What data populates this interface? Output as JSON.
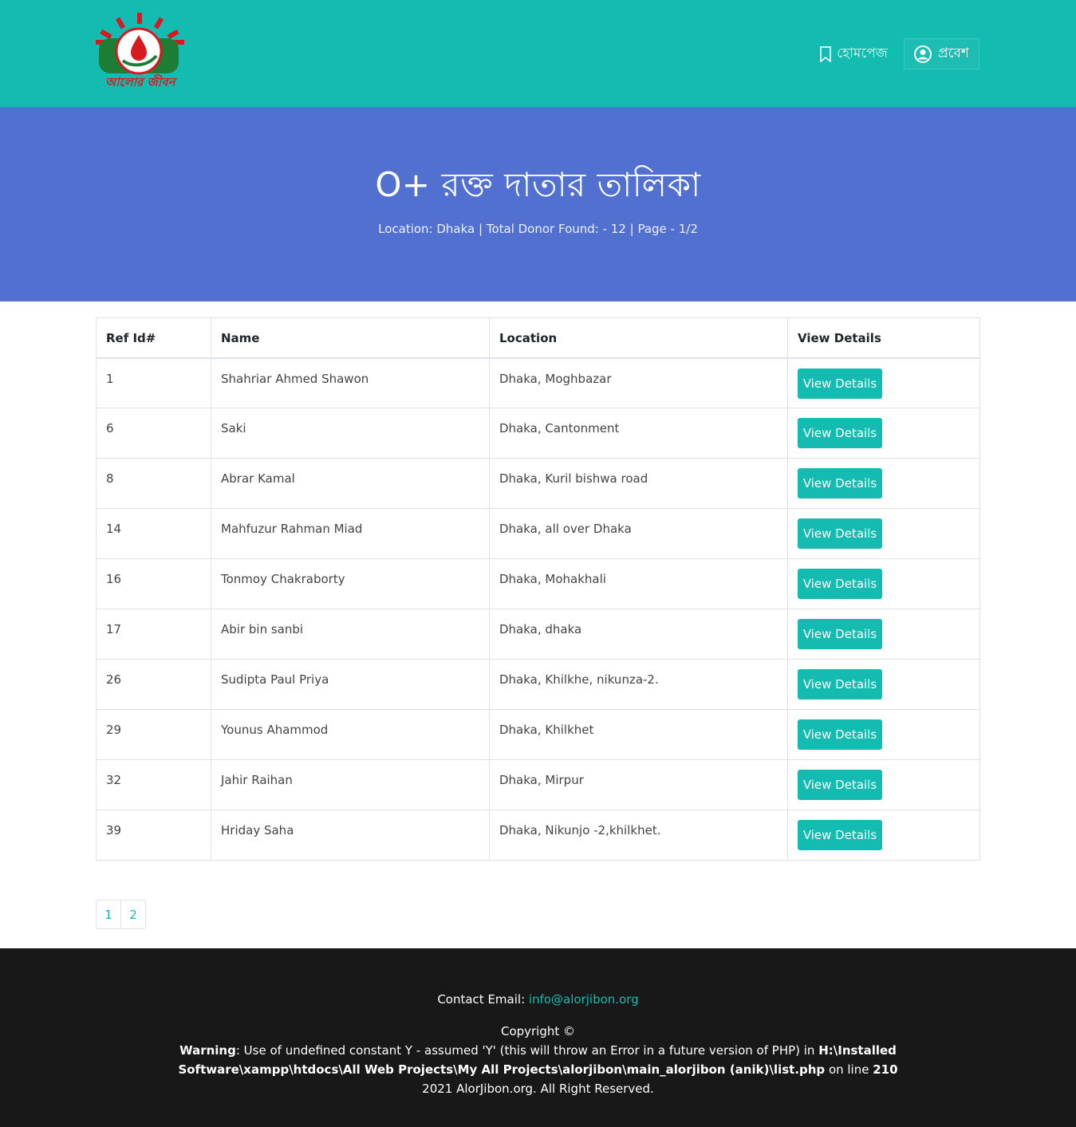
{
  "brand": {
    "logo_text": "আলোর জীবন"
  },
  "nav": {
    "home_label": "হোমপেজ",
    "login_label": "প্রবেশ"
  },
  "hero": {
    "title": "O+ রক্ত দাতার তালিকা",
    "subtitle": "Location: Dhaka | Total Donor Found: - 12 | Page - 1/2"
  },
  "table": {
    "headers": [
      "Ref Id#",
      "Name",
      "Location",
      "View Details"
    ],
    "button_label": "View Details",
    "rows": [
      {
        "id": "1",
        "name": "Shahriar Ahmed Shawon",
        "location": "Dhaka, Moghbazar"
      },
      {
        "id": "6",
        "name": "Saki",
        "location": "Dhaka, Cantonment"
      },
      {
        "id": "8",
        "name": "Abrar Kamal",
        "location": "Dhaka, Kuril bishwa road"
      },
      {
        "id": "14",
        "name": "Mahfuzur Rahman Miad",
        "location": "Dhaka, all over Dhaka"
      },
      {
        "id": "16",
        "name": "Tonmoy Chakraborty",
        "location": "Dhaka, Mohakhali"
      },
      {
        "id": "17",
        "name": "Abir bin sanbi",
        "location": "Dhaka, dhaka"
      },
      {
        "id": "26",
        "name": "Sudipta Paul Priya",
        "location": "Dhaka, Khilkhe, nikunza-2."
      },
      {
        "id": "29",
        "name": "Younus Ahammod",
        "location": "Dhaka, Khilkhet"
      },
      {
        "id": "32",
        "name": "Jahir Raihan",
        "location": "Dhaka, Mirpur"
      },
      {
        "id": "39",
        "name": "Hriday Saha",
        "location": "Dhaka, Nikunjo -2,khilkhet."
      }
    ]
  },
  "pagination": {
    "pages": [
      "1",
      "2"
    ]
  },
  "footer": {
    "contact_label": "Contact Email:",
    "email": "info@alorjibon.org",
    "copyright": "Copyright ©",
    "warning_label": "Warning",
    "warning_text": ": Use of undefined constant Y - assumed 'Y' (this will throw an Error in a future version of PHP) in ",
    "warning_path": "H:\\Installed Software\\xampp\\htdocs\\All Web Projects\\My All Projects\\alorjibon\\main_alorjibon (anik)\\list.php",
    "warning_on_line": " on line ",
    "warning_line": "210",
    "rights": "2021 AlorJibon.org. All Right Reserved."
  },
  "colors": {
    "header": "#14bbb1",
    "hero": "#5170d0",
    "footer": "#181818",
    "accent": "#14bbb1"
  }
}
